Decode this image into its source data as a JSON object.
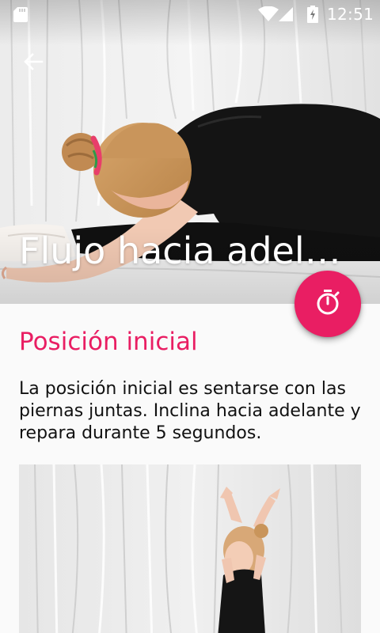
{
  "status_bar": {
    "time": "12:51",
    "icons": [
      "sd-card-icon",
      "wifi-icon",
      "cell-signal-icon",
      "battery-charging-icon"
    ]
  },
  "toolbar": {
    "back_icon": "arrow-back-icon",
    "title": "Flujo hacia adela..."
  },
  "fab": {
    "icon": "timer-icon",
    "color": "#e91e63"
  },
  "content": {
    "heading": "Posición inicial",
    "description": "La posición inicial es sentarse con las piernas juntas. Inclina hacia adelante y repara durante 5 segundos."
  },
  "colors": {
    "accent": "#e91e63",
    "background": "#fafafa",
    "text": "#111111"
  }
}
